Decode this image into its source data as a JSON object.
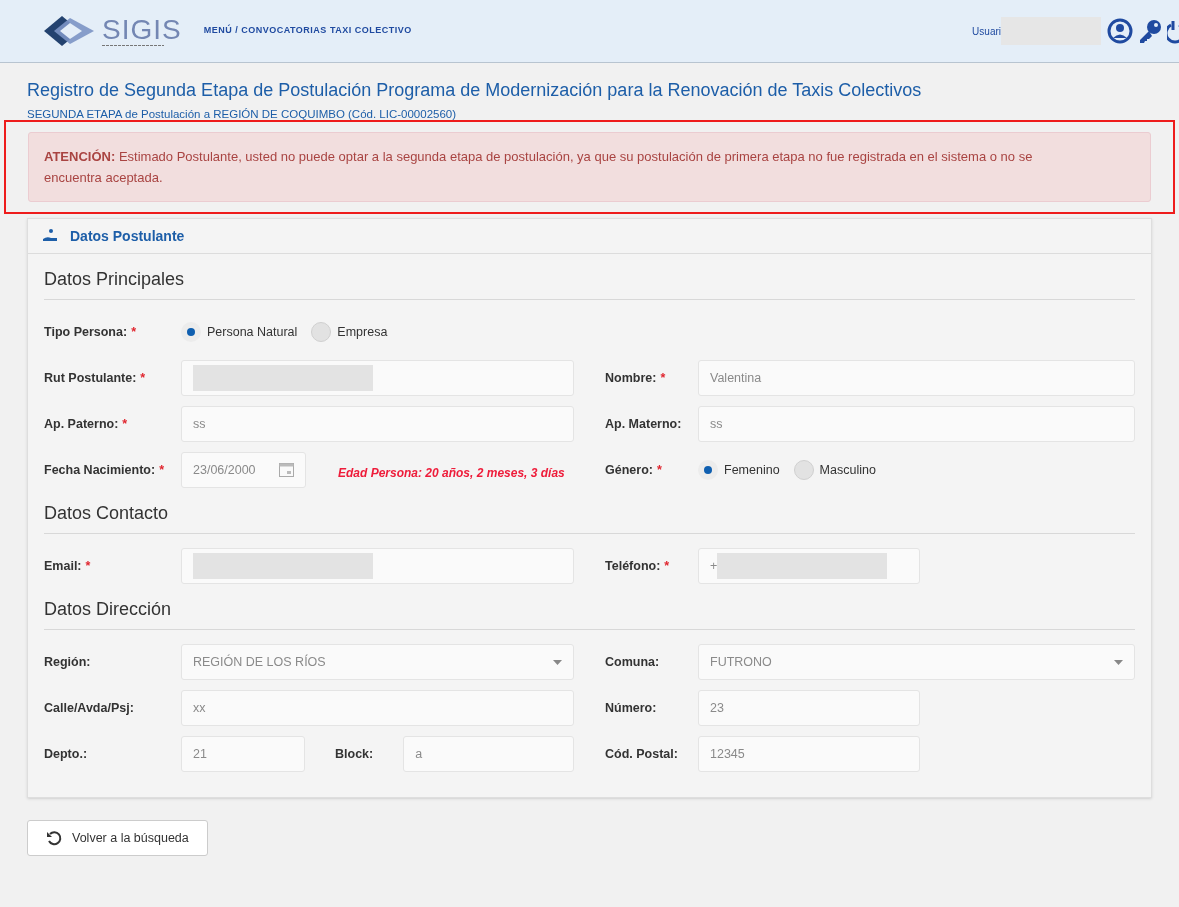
{
  "header": {
    "logo_text": "SIGIS",
    "breadcrumb": "MENÚ / CONVOCATORIAS TAXI COLECTIVO",
    "user_label": "Usuari"
  },
  "page": {
    "title": "Registro de Segunda Etapa de Postulación Programa de Modernización para la Renovación de Taxis Colectivos",
    "subtitle": "SEGUNDA ETAPA de Postulación a REGIÓN DE COQUIMBO (Cód. LIC-00002560)"
  },
  "alert": {
    "highlighted": true,
    "label": "ATENCIÓN:",
    "message": "Estimado Postulante, usted no puede optar a la segunda etapa de postulación, ya que su postulación de primera etapa no fue registrada en el sistema o no se encuentra aceptada."
  },
  "panel": {
    "title": "Datos Postulante"
  },
  "sections": [
    {
      "title": "Datos Principales",
      "rows": [
        {
          "left": [
            {
              "kind": "radio",
              "label": "Tipo Persona:",
              "required_mark": "*",
              "options": [
                {
                  "label": "Persona Natural",
                  "selected": true
                },
                {
                  "label": "Empresa",
                  "selected": false
                }
              ]
            }
          ],
          "right": []
        },
        {
          "left": [
            {
              "kind": "redacted",
              "label": "Rut Postulante:",
              "required_mark": "*"
            }
          ],
          "right": [
            {
              "kind": "text",
              "label": "Nombre:",
              "required_mark": "*",
              "value": "Valentina"
            }
          ]
        },
        {
          "left": [
            {
              "kind": "text",
              "label": "Ap. Paterno:",
              "required_mark": "*",
              "value": "ss"
            }
          ],
          "right": [
            {
              "kind": "text",
              "label": "Ap. Materno:",
              "value": "ss"
            }
          ]
        },
        {
          "left": [
            {
              "kind": "date",
              "label": "Fecha Nacimiento:",
              "required_mark": "*",
              "value": "23/06/2000"
            },
            {
              "kind": "note",
              "value": "Edad Persona: 20 años, 2 meses, 3 días"
            }
          ],
          "right": [
            {
              "kind": "radio",
              "label": "Género:",
              "required_mark": "*",
              "options": [
                {
                  "label": "Femenino",
                  "selected": true
                },
                {
                  "label": "Masculino",
                  "selected": false
                }
              ]
            }
          ]
        }
      ]
    },
    {
      "title": "Datos Contacto",
      "rows": [
        {
          "left": [
            {
              "kind": "redacted",
              "label": "Email:",
              "required_mark": "*"
            }
          ],
          "right": [
            {
              "kind": "redacted_short",
              "label": "Teléfono:",
              "required_mark": "*",
              "value": "+"
            }
          ]
        }
      ]
    },
    {
      "title": "Datos Dirección",
      "rows": [
        {
          "left": [
            {
              "kind": "select",
              "label": "Región:",
              "value": "REGIÓN DE LOS RÍOS"
            }
          ],
          "right": [
            {
              "kind": "select",
              "label": "Comuna:",
              "value": "FUTRONO"
            }
          ]
        },
        {
          "left": [
            {
              "kind": "text",
              "label": "Calle/Avda/Psj:",
              "value": "xx"
            }
          ],
          "right": [
            {
              "kind": "short_text",
              "label": "Número:",
              "value": "23"
            }
          ]
        },
        {
          "left": [
            {
              "kind": "short_text",
              "label": "Depto.:",
              "value": "21"
            },
            {
              "kind": "text",
              "label": "Block:",
              "value": "a"
            }
          ],
          "right": [
            {
              "kind": "short_text",
              "label": "Cód. Postal:",
              "value": "12345"
            }
          ]
        }
      ]
    }
  ],
  "back_button": {
    "label": "Volver a la búsqueda"
  }
}
